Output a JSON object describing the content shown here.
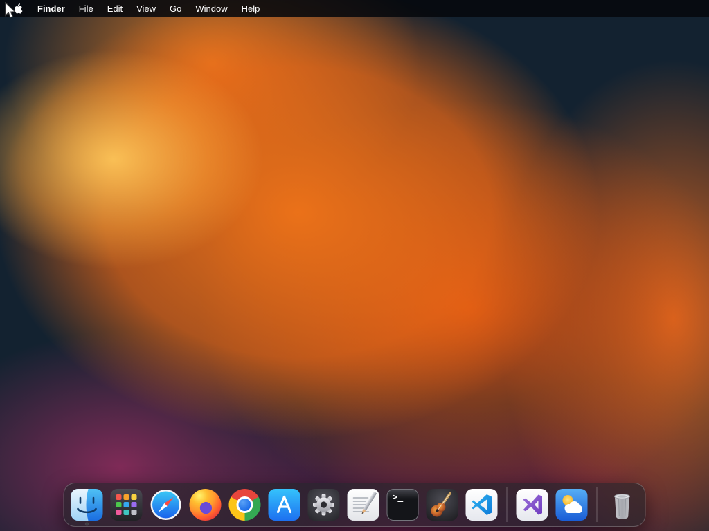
{
  "menu_bar": {
    "app_menu": "Finder",
    "items": [
      "File",
      "Edit",
      "View",
      "Go",
      "Window",
      "Help"
    ]
  },
  "dock": {
    "items": [
      {
        "id": "finder",
        "name": "Finder",
        "running": true
      },
      {
        "id": "launchpad",
        "name": "Launchpad"
      },
      {
        "id": "safari",
        "name": "Safari"
      },
      {
        "id": "firefox",
        "name": "Firefox"
      },
      {
        "id": "chrome",
        "name": "Google Chrome"
      },
      {
        "id": "app-store",
        "name": "App Store"
      },
      {
        "id": "system-settings",
        "name": "System Settings"
      },
      {
        "id": "textedit",
        "name": "TextEdit"
      },
      {
        "id": "terminal",
        "name": "Terminal"
      },
      {
        "id": "garageband",
        "name": "GarageBand"
      },
      {
        "id": "vscode",
        "name": "Visual Studio Code"
      },
      {
        "id": "visual-studio",
        "name": "Visual Studio"
      },
      {
        "id": "weather",
        "name": "Weather"
      },
      {
        "id": "trash",
        "name": "Trash"
      }
    ],
    "terminal_glyph": ">_"
  },
  "colors": {
    "menu_bar_bg": "#06080c",
    "dock_bg": "#26272a",
    "wallpaper_navy": "#132230",
    "wallpaper_orange": "#ee6916",
    "wallpaper_highlight": "#ffc85a",
    "wallpaper_purple": "#7a2455"
  }
}
